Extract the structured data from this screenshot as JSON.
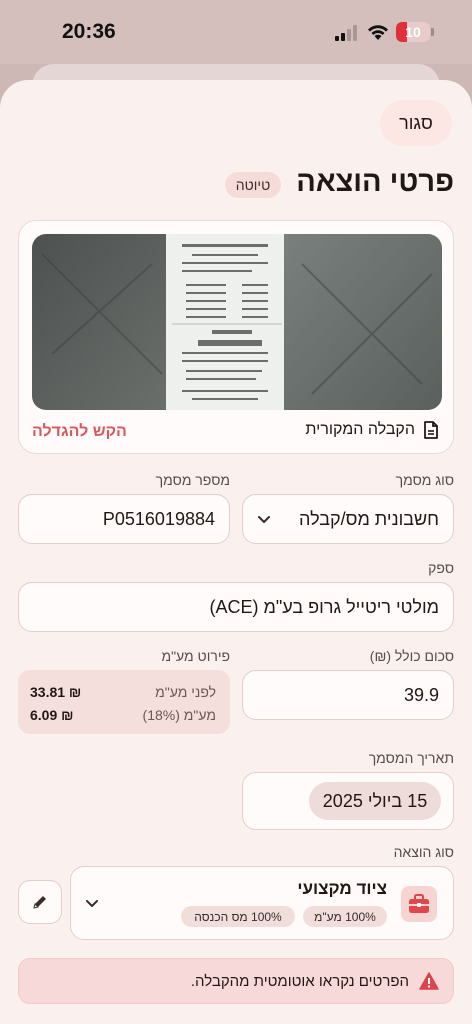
{
  "status_bar": {
    "time": "20:36",
    "battery": "10"
  },
  "header": {
    "close_label": "סגור",
    "title": "פרטי הוצאה",
    "badge": "טיוטה"
  },
  "receipt": {
    "caption": "הקבלה המקורית",
    "zoom_label": "הקש להגדלה"
  },
  "document_type": {
    "label": "סוג מסמך",
    "value": "חשבונית מס/קבלה"
  },
  "document_number": {
    "label": "מספר מסמך",
    "value": "P0516019884"
  },
  "supplier": {
    "label": "ספק",
    "value": "מולטי ריטייל גרופ בע\"מ (ACE)"
  },
  "total": {
    "label": "סכום כולל (₪)",
    "value": "39.9"
  },
  "vat_breakdown": {
    "label": "פירוט מע\"מ",
    "before_vat_label": "לפני מע\"מ",
    "before_vat_value": "33.81 ₪",
    "vat_label": "מע\"מ (18%)",
    "vat_value": "6.09 ₪"
  },
  "document_date": {
    "label": "תאריך המסמך",
    "value": "15 ביולי 2025"
  },
  "expense_type": {
    "label": "סוג הוצאה",
    "name": "ציוד מקצועי",
    "tags": [
      "100% מע\"מ",
      "100% מס הכנסה"
    ],
    "icon": "briefcase-icon"
  },
  "alert": {
    "text": "הפרטים נקראו אוטומטית מהקבלה."
  },
  "colors": {
    "accent": "#d8595d",
    "sheet": "#faf1ef",
    "alert_bg": "#f8d9d9"
  }
}
